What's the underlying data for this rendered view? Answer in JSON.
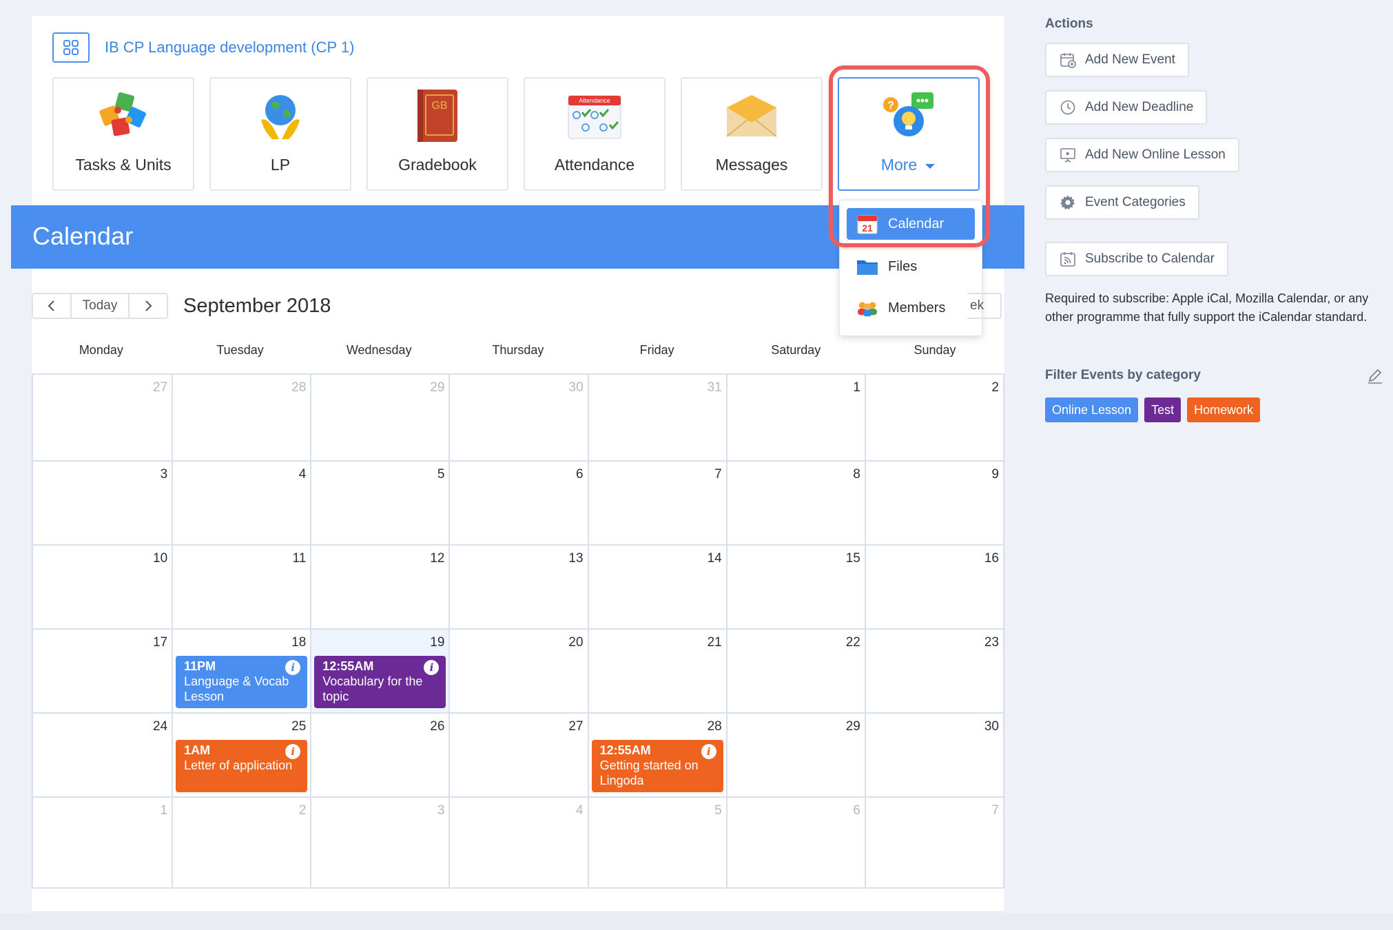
{
  "course": {
    "title": "IB CP Language development (CP 1)"
  },
  "tiles": [
    {
      "label": "Tasks & Units",
      "icon": "puzzle-icon"
    },
    {
      "label": "LP",
      "icon": "globe-hands-icon"
    },
    {
      "label": "Gradebook",
      "icon": "gradebook-book-icon",
      "icon_text": "GB"
    },
    {
      "label": "Attendance",
      "icon": "attendance-sheet-icon",
      "icon_text": "Attendance"
    },
    {
      "label": "Messages",
      "icon": "envelope-icon"
    },
    {
      "label": "More",
      "icon": "lightbulb-chat-icon"
    }
  ],
  "dropdown": {
    "items": [
      {
        "label": "Calendar",
        "icon": "calendar-icon",
        "icon_text": "21",
        "active": true
      },
      {
        "label": "Files",
        "icon": "folder-icon"
      },
      {
        "label": "Members",
        "icon": "members-icon"
      }
    ]
  },
  "calendar": {
    "header": "Calendar",
    "today_label": "Today",
    "month_title": "September 2018",
    "view_button_fragment": "ek",
    "weekdays": [
      "Monday",
      "Tuesday",
      "Wednesday",
      "Thursday",
      "Friday",
      "Saturday",
      "Sunday"
    ],
    "weeks": [
      [
        "27",
        "28",
        "29",
        "30",
        "31",
        "1",
        "2"
      ],
      [
        "3",
        "4",
        "5",
        "6",
        "7",
        "8",
        "9"
      ],
      [
        "10",
        "11",
        "12",
        "13",
        "14",
        "15",
        "16"
      ],
      [
        "17",
        "18",
        "19",
        "20",
        "21",
        "22",
        "23"
      ],
      [
        "24",
        "25",
        "26",
        "27",
        "28",
        "29",
        "30"
      ],
      [
        "1",
        "2",
        "3",
        "4",
        "5",
        "6",
        "7"
      ]
    ],
    "events": [
      {
        "time": "11PM",
        "title": "Language & Vocab Lesson",
        "category": "Online Lesson",
        "day": "18"
      },
      {
        "time": "12:55AM",
        "title": "Vocabulary for the topic",
        "category": "Test",
        "day": "19"
      },
      {
        "time": "1AM",
        "title": "Letter of application",
        "category": "Homework",
        "day": "25"
      },
      {
        "time": "12:55AM",
        "title": "Getting started on Lingoda",
        "category": "Homework",
        "day": "28"
      }
    ]
  },
  "sidebar": {
    "actions_heading": "Actions",
    "actions": [
      {
        "label": "Add New Event",
        "icon": "calendar-add-icon"
      },
      {
        "label": "Add New Deadline",
        "icon": "clock-icon"
      },
      {
        "label": "Add New Online Lesson",
        "icon": "presentation-icon"
      },
      {
        "label": "Event Categories",
        "icon": "gear-icon"
      },
      {
        "label": "Subscribe to Calendar",
        "icon": "rss-calendar-icon"
      }
    ],
    "subscribe_note": "Required to subscribe: Apple iCal, Mozilla Calendar, or any other programme that fully support the iCalendar standard.",
    "filter_heading": "Filter Events by category",
    "categories": [
      {
        "label": "Online Lesson",
        "color": "#4a8ff0"
      },
      {
        "label": "Test",
        "color": "#6b2a96"
      },
      {
        "label": "Homework",
        "color": "#ee6320"
      }
    ]
  }
}
